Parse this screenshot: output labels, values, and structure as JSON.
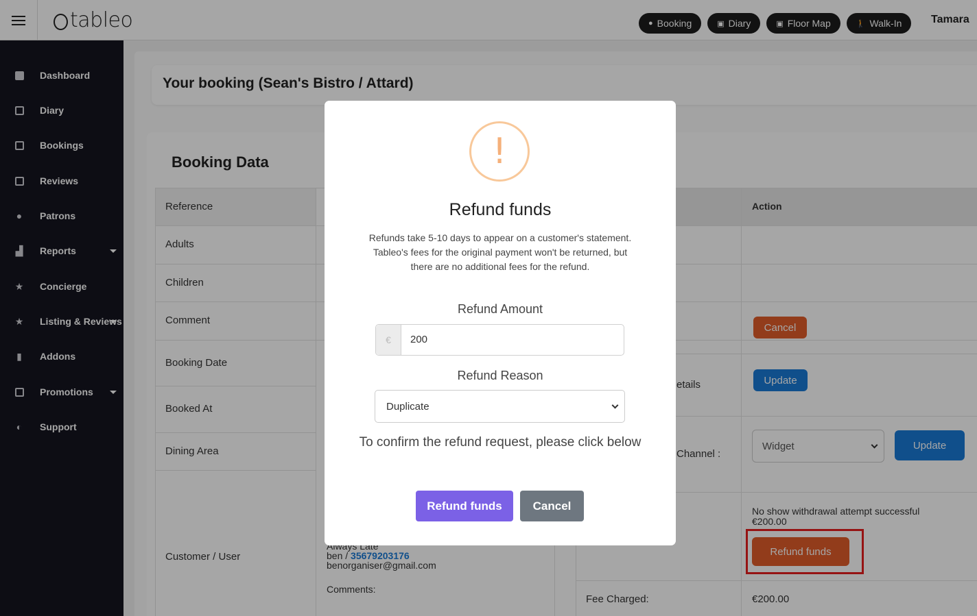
{
  "topbar": {
    "logo": "tableo",
    "buttons": [
      {
        "label": "Booking",
        "icon": "plus-circle-icon"
      },
      {
        "label": "Diary",
        "icon": "calendar-icon"
      },
      {
        "label": "Floor Map",
        "icon": "map-icon"
      },
      {
        "label": "Walk-In",
        "icon": "walking-icon"
      }
    ],
    "user": "Tamara"
  },
  "sidebar": {
    "items": [
      {
        "label": "Dashboard",
        "icon": "dashboard-icon"
      },
      {
        "label": "Diary",
        "icon": "calendar-icon"
      },
      {
        "label": "Bookings",
        "icon": "bookings-icon"
      },
      {
        "label": "Reviews",
        "icon": "reviews-icon"
      },
      {
        "label": "Patrons",
        "icon": "user-icon"
      },
      {
        "label": "Reports",
        "icon": "chart-icon",
        "has_submenu": true
      },
      {
        "label": "Concierge",
        "icon": "star-icon"
      },
      {
        "label": "Listing & Reviews",
        "icon": "star-icon",
        "has_submenu": true
      },
      {
        "label": "Addons",
        "icon": "addon-icon"
      },
      {
        "label": "Promotions",
        "icon": "gift-icon",
        "has_submenu": true
      },
      {
        "label": "Support",
        "icon": "headset-icon"
      }
    ]
  },
  "page": {
    "title": "Your booking (Sean's Bistro / Attard)",
    "card_title": "Booking Data"
  },
  "table": {
    "rows": [
      "Reference",
      "Adults",
      "Children",
      "Comment",
      "Booking Date",
      "Booked At",
      "Dining Area",
      "Customer / User"
    ],
    "action_header": "Action",
    "cancel_label": "Cancel",
    "update_label": "Update",
    "details_partial": "etails",
    "channel_partial": "Channel :",
    "channel_select": "Widget",
    "channel_update_label": "Update",
    "no_show_text": "No show withdrawal attempt successful",
    "no_show_amount": "€200.00",
    "refund_funds_label": "Refund funds",
    "fee_label": "Fee Charged:",
    "fee_value": "€200.00",
    "customer": {
      "tag": "Always Late",
      "name": "ben /",
      "phone": "35679203176",
      "email": "benorganiser@gmail.com",
      "comments_label": "Comments:"
    }
  },
  "modal": {
    "title": "Refund funds",
    "description": "Refunds take 5-10 days to appear on a customer's statement. Tableo's fees for the original payment won't be returned, but there are no additional fees for the refund.",
    "amount_label": "Refund Amount",
    "currency": "€",
    "amount_value": "200",
    "reason_label": "Refund Reason",
    "reason_value": "Duplicate",
    "confirm_text": "To confirm the refund request, please click below",
    "confirm_button": "Refund funds",
    "cancel_button": "Cancel",
    "warning_color": "#f8c89a",
    "confirm_color": "#7b61e6"
  }
}
